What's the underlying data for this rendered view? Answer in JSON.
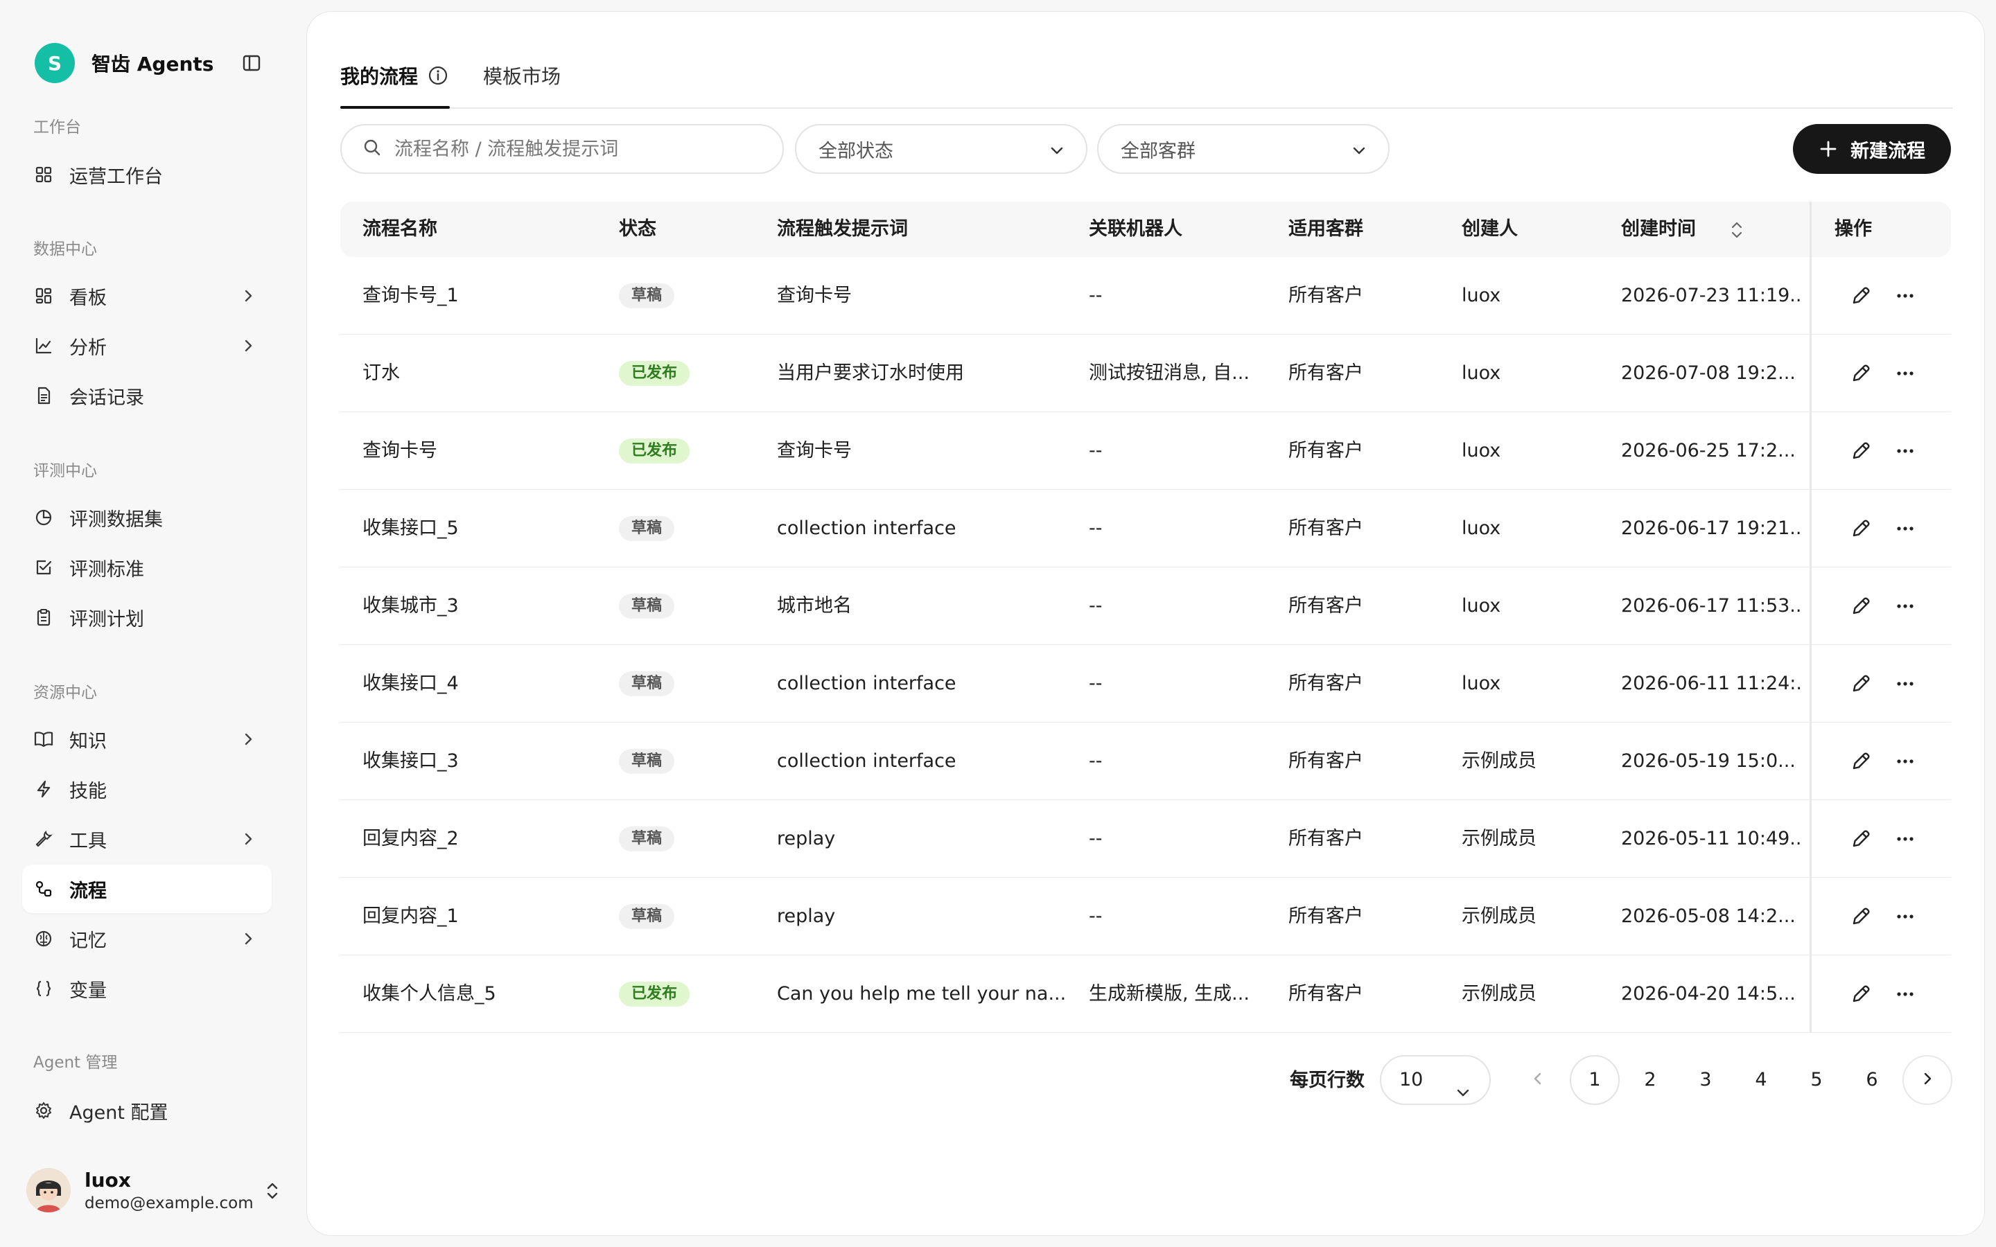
{
  "brand": {
    "logo_letter": "S",
    "name": "智齿 Agents"
  },
  "sidebar": {
    "sections": [
      {
        "title": "工作台"
      },
      {
        "title": "数据中心"
      },
      {
        "title": "评测中心"
      },
      {
        "title": "资源中心"
      },
      {
        "title": "Agent 管理"
      }
    ],
    "items": [
      {
        "label": "运营工作台",
        "icon": "grid-icon"
      },
      {
        "label": "看板",
        "icon": "dashboard-icon",
        "expandable": true
      },
      {
        "label": "分析",
        "icon": "chart-icon",
        "expandable": true
      },
      {
        "label": "会话记录",
        "icon": "document-icon"
      },
      {
        "label": "评测数据集",
        "icon": "pie-icon"
      },
      {
        "label": "评测标准",
        "icon": "checkbox-icon"
      },
      {
        "label": "评测计划",
        "icon": "clipboard-icon"
      },
      {
        "label": "知识",
        "icon": "book-icon",
        "expandable": true
      },
      {
        "label": "技能",
        "icon": "lightning-icon"
      },
      {
        "label": "工具",
        "icon": "wrench-icon",
        "expandable": true
      },
      {
        "label": "流程",
        "icon": "flow-icon",
        "active": true
      },
      {
        "label": "记忆",
        "icon": "brain-icon",
        "expandable": true
      },
      {
        "label": "变量",
        "icon": "braces-icon"
      },
      {
        "label": "Agent 配置",
        "icon": "gear-icon"
      }
    ]
  },
  "user": {
    "name": "luox",
    "email": "demo@example.com"
  },
  "tabs": [
    {
      "label": "我的流程",
      "active": true
    },
    {
      "label": "模板市场"
    }
  ],
  "filters": {
    "search_placeholder": "流程名称 / 流程触发提示词",
    "status": "全部状态",
    "customer_group": "全部客群",
    "new_button": "新建流程"
  },
  "table": {
    "columns": [
      "流程名称",
      "状态",
      "流程触发提示词",
      "关联机器人",
      "适用客群",
      "创建人",
      "创建时间",
      "操作"
    ],
    "rows": [
      {
        "name": "查询卡号_1",
        "status": "草稿",
        "trigger": "查询卡号",
        "bots": "--",
        "group": "所有客户",
        "creator": "luox",
        "created": "2026-07-23 11:19..."
      },
      {
        "name": "订水",
        "status": "已发布",
        "trigger": "当用户要求订水时使用",
        "bots": "测试按钮消息, 自...",
        "group": "所有客户",
        "creator": "luox",
        "created": "2026-07-08 19:2..."
      },
      {
        "name": "查询卡号",
        "status": "已发布",
        "trigger": "查询卡号",
        "bots": "--",
        "group": "所有客户",
        "creator": "luox",
        "created": "2026-06-25 17:2..."
      },
      {
        "name": "收集接口_5",
        "status": "草稿",
        "trigger": "collection interface",
        "bots": "--",
        "group": "所有客户",
        "creator": "luox",
        "created": "2026-06-17 19:21..."
      },
      {
        "name": "收集城市_3",
        "status": "草稿",
        "trigger": "城市地名",
        "bots": "--",
        "group": "所有客户",
        "creator": "luox",
        "created": "2026-06-17 11:53..."
      },
      {
        "name": "收集接口_4",
        "status": "草稿",
        "trigger": "collection interface",
        "bots": "--",
        "group": "所有客户",
        "creator": "luox",
        "created": "2026-06-11 11:24:..."
      },
      {
        "name": "收集接口_3",
        "status": "草稿",
        "trigger": "collection interface",
        "bots": "--",
        "group": "所有客户",
        "creator": "示例成员",
        "created": "2026-05-19 15:0..."
      },
      {
        "name": "回复内容_2",
        "status": "草稿",
        "trigger": "replay",
        "bots": "--",
        "group": "所有客户",
        "creator": "示例成员",
        "created": "2026-05-11 10:49..."
      },
      {
        "name": "回复内容_1",
        "status": "草稿",
        "trigger": "replay",
        "bots": "--",
        "group": "所有客户",
        "creator": "示例成员",
        "created": "2026-05-08 14:2..."
      },
      {
        "name": "收集个人信息_5",
        "status": "已发布",
        "trigger": "Can you help me tell your na...",
        "bots": "生成新模版, 生成...",
        "group": "所有客户",
        "creator": "示例成员",
        "created": "2026-04-20 14:5..."
      }
    ]
  },
  "pagination": {
    "rows_label": "每页行数",
    "rows_per_page": "10",
    "pages": [
      "1",
      "2",
      "3",
      "4",
      "5",
      "6"
    ],
    "current": "1"
  },
  "colors": {
    "accent": "#15bfa6",
    "primary_button": "#171717",
    "published_bg": "#dff6cf",
    "published_text": "#2f7d1f",
    "draft_bg": "#f0f0f0"
  }
}
